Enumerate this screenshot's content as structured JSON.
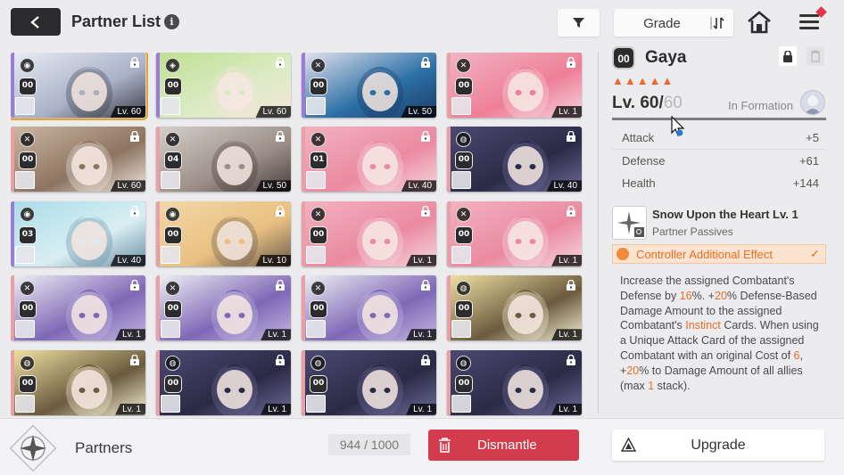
{
  "header": {
    "title": "Partner List",
    "info_icon": "i",
    "grade_label": "Grade"
  },
  "partners": [
    {
      "role": "◉",
      "badge": "00",
      "level": "Lv. 60",
      "selected": true,
      "rarity": "#9b7bd8",
      "art": [
        "#e8ecf4",
        "#a9b1c7",
        "#3b3b45"
      ]
    },
    {
      "role": "◈",
      "badge": "00",
      "level": "Lv. 60",
      "rarity": "#9b7bd8",
      "art": [
        "#bfe08f",
        "#dcebc6",
        "#f3e6da"
      ]
    },
    {
      "role": "✕",
      "badge": "00",
      "level": "Lv. 50",
      "rarity": "#9b7bd8",
      "art": [
        "#e7e3ef",
        "#2a6fa5",
        "#1d3c66"
      ]
    },
    {
      "role": "✕",
      "badge": "00",
      "level": "Lv. 1",
      "rarity": "#e8a0a6",
      "art": [
        "#f2b5c4",
        "#ee7f97",
        "#f6d3dc"
      ]
    },
    {
      "role": "✕",
      "badge": "00",
      "level": "Lv. 60",
      "rarity": "#e8a0a6",
      "art": [
        "#cdb7a3",
        "#8c7461",
        "#efe6df"
      ]
    },
    {
      "role": "✕",
      "badge": "04",
      "level": "Lv. 50",
      "rarity": "#e8a0a6",
      "art": [
        "#d5d0cb",
        "#9c8f88",
        "#4b403f"
      ]
    },
    {
      "role": "✕",
      "badge": "01",
      "level": "Lv. 40",
      "rarity": "#e8a0a6",
      "art": [
        "#f3b3c1",
        "#ea8aa1",
        "#f7d7df"
      ]
    },
    {
      "role": "◍",
      "badge": "00",
      "level": "Lv. 40",
      "rarity": "#e8a0a6",
      "art": [
        "#4c4a73",
        "#2b2a45",
        "#6d6b9a"
      ]
    },
    {
      "role": "◉",
      "badge": "03",
      "level": "Lv. 40",
      "rarity": "#9b7bd8",
      "art": [
        "#a8dde8",
        "#d9eef2",
        "#6a8ea5"
      ]
    },
    {
      "role": "◉",
      "badge": "00",
      "level": "Lv. 10",
      "rarity": "#e8a0a6",
      "art": [
        "#f3d7a7",
        "#e9c082",
        "#6a5b4c"
      ]
    },
    {
      "role": "✕",
      "badge": "00",
      "level": "Lv. 1",
      "rarity": "#e8a0a6",
      "art": [
        "#f3b3c1",
        "#ea8aa1",
        "#f7d7df"
      ]
    },
    {
      "role": "✕",
      "badge": "00",
      "level": "Lv. 1",
      "rarity": "#e8a0a6",
      "art": [
        "#f3b3c1",
        "#ea8aa1",
        "#f7d7df"
      ]
    },
    {
      "role": "✕",
      "badge": "00",
      "level": "Lv. 1",
      "rarity": "#e8a0a6",
      "art": [
        "#f0f0f4",
        "#7e68b6",
        "#c4b8e0"
      ]
    },
    {
      "role": "✕",
      "badge": "00",
      "level": "Lv. 1",
      "rarity": "#e8a0a6",
      "art": [
        "#f0f0f4",
        "#7e68b6",
        "#c4b8e0"
      ]
    },
    {
      "role": "✕",
      "badge": "00",
      "level": "Lv. 1",
      "rarity": "#e8a0a6",
      "art": [
        "#f0f0f4",
        "#7e68b6",
        "#c4b8e0"
      ]
    },
    {
      "role": "◍",
      "badge": "00",
      "level": "Lv. 1",
      "rarity": "#e8a0a6",
      "art": [
        "#f1e3a2",
        "#6b5b3f",
        "#f5efd4"
      ]
    },
    {
      "role": "◍",
      "badge": "00",
      "level": "Lv. 1",
      "rarity": "#e8a0a6",
      "art": [
        "#f1e3a2",
        "#6b5b3f",
        "#f5efd4"
      ]
    },
    {
      "role": "◍",
      "badge": "00",
      "level": "Lv. 1",
      "rarity": "#e8a0a6",
      "art": [
        "#4c4a73",
        "#2b2a45",
        "#6d6b9a"
      ]
    },
    {
      "role": "◍",
      "badge": "00",
      "level": "Lv. 1",
      "rarity": "#e8a0a6",
      "art": [
        "#4c4a73",
        "#2b2a45",
        "#6d6b9a"
      ]
    },
    {
      "role": "◍",
      "badge": "00",
      "level": "Lv. 1",
      "rarity": "#e8a0a6",
      "art": [
        "#4c4a73",
        "#2b2a45",
        "#6d6b9a"
      ]
    }
  ],
  "detail": {
    "badge": "00",
    "name": "Gaya",
    "stars": "▲▲▲▲▲",
    "level_current": "Lv. 60/",
    "level_max": "60",
    "in_formation": "In Formation",
    "level_progress": 1.0,
    "stats": [
      {
        "name": "Attack",
        "value": "+5"
      },
      {
        "name": "Defense",
        "value": "+61"
      },
      {
        "name": "Health",
        "value": "+144"
      }
    ],
    "passive_name": "Snow Upon the Heart Lv. 1",
    "passive_sub": "Partner Passives",
    "controller_effect": "Controller Additional Effect",
    "desc": {
      "p1": "Increase the assigned Combatant's Defense by ",
      "h1": "16",
      "p2": "%. +",
      "h2": "20",
      "p3": "% Defense-Based Damage Amount to the assigned Combatant's ",
      "h3": "Instinct",
      "p4": " Cards. When using a Unique Attack Card of the assigned Combatant with an original Cost of ",
      "h4": "6",
      "p5": ", +",
      "h5": "20",
      "p6": "% to Damage Amount of all allies (max ",
      "h6": "1",
      "p7": " stack)."
    }
  },
  "bottom": {
    "title": "Partners",
    "count": "944 / 1000",
    "dismantle_label": "Dismantle",
    "upgrade_label": "Upgrade"
  },
  "colors": {
    "accent": "#ea6d25",
    "danger": "#d23c4c",
    "selected_border": "#e6a530"
  }
}
